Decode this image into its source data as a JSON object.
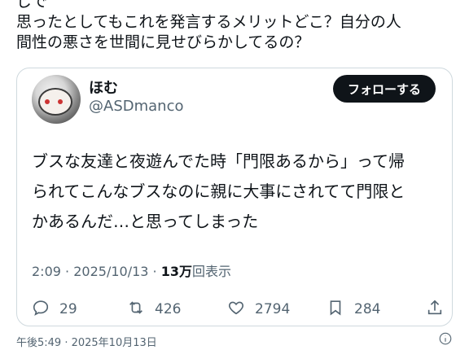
{
  "post_text": "じで\n思ったとしてもこれを発言するメリットどこ？自分の人\n間性の悪さを世間に見せびらかしてるの？",
  "quoted": {
    "display_name": "ほむ",
    "handle": "@ASDmanco",
    "follow_label": "フォローする",
    "body": "ブスな友達と夜遊んでた時「門限あるから」って帰\nられてこんなブスなのに親に大事にされてて門限と\nかあるんだ…と思ってしまった",
    "time": "2:09",
    "separator": "·",
    "date": "2025/10/13",
    "views_count": "13万",
    "views_label": "回表示",
    "replies": "29",
    "reposts": "426",
    "likes": "2794",
    "bookmarks": "284"
  },
  "footer": {
    "timestamp": "午後5:49 · 2025年10月13日"
  },
  "icons": {
    "reply": "reply-icon",
    "repost": "repost-icon",
    "like": "heart-icon",
    "bookmark": "bookmark-icon",
    "share": "share-icon",
    "info": "info-icon"
  },
  "colors": {
    "text": "#0f1419",
    "secondary": "#536471",
    "border": "#cfd9de",
    "follow_bg": "#0f1419"
  }
}
